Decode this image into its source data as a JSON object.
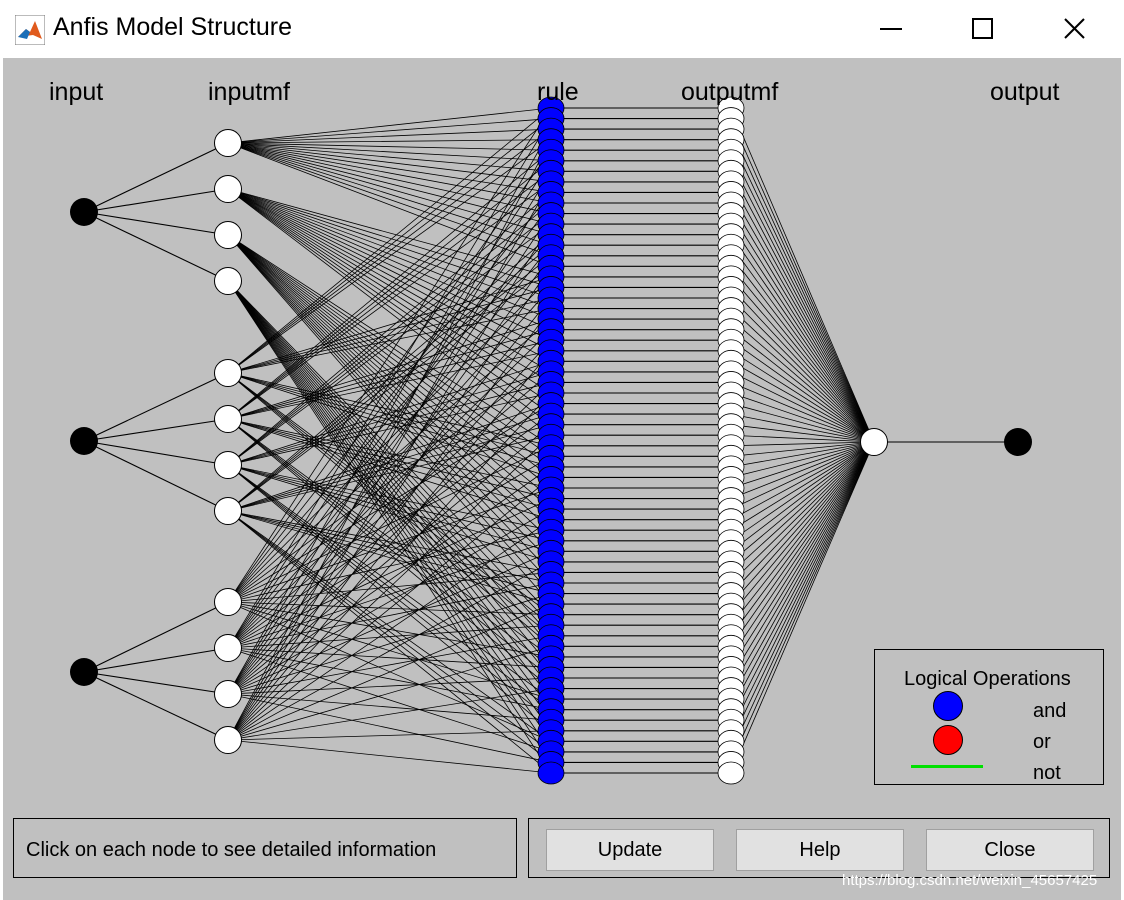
{
  "window": {
    "title": "Anfis Model Structure",
    "app_icon": "matlab-icon",
    "controls": [
      "minimize-icon",
      "maximize-icon",
      "close-icon"
    ]
  },
  "diagram": {
    "columns": {
      "input": "input",
      "inputmf": "inputmf",
      "rule": "rule",
      "outputmf": "outputmf",
      "output": "output"
    },
    "counts": {
      "inputs": 3,
      "mfs_per_input": 4,
      "rules": 64,
      "outputmfs": 64,
      "outputs": 1
    },
    "colors": {
      "and": "#0000ff",
      "or": "#ff0000",
      "not": "#00ff00",
      "line": "#000000",
      "bg": "#c0c0c0"
    }
  },
  "legend": {
    "title": "Logical Operations",
    "items": [
      {
        "label": "and",
        "color": "#0000ff"
      },
      {
        "label": "or",
        "color": "#ff0000"
      },
      {
        "label": "not",
        "color": "#00ff00"
      }
    ]
  },
  "status": {
    "text": "Click on each node to see detailed information"
  },
  "buttons": {
    "update": "Update",
    "help": "Help",
    "close": "Close"
  },
  "watermark": "https://blog.csdn.net/weixin_45657425"
}
